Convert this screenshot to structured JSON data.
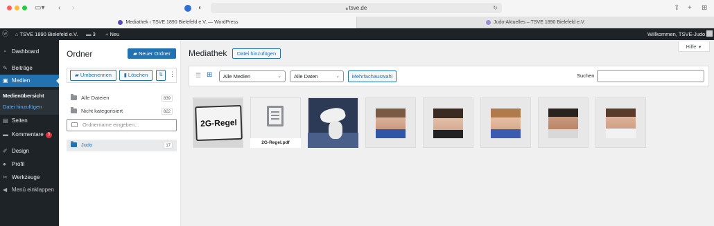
{
  "browser": {
    "url": "tsve.de",
    "tabs": [
      {
        "label": "Mediathek ‹ TSVE 1890 Bielefeld e.V. — WordPress"
      },
      {
        "label": "Judo-Aktuelles – TSVE 1890 Bielefeld e.V."
      }
    ]
  },
  "adminbar": {
    "site_name": "TSVE 1890 Bielefeld e.V.",
    "comments_count": "3",
    "new_label": "Neu",
    "welcome": "Willkommen, TSVE-Judo"
  },
  "menu": {
    "items": [
      {
        "label": "Dashboard",
        "icon": "dashboard-icon"
      },
      {
        "label": "Beiträge",
        "icon": "pin-icon"
      },
      {
        "label": "Medien",
        "icon": "media-icon"
      },
      {
        "label": "Seiten",
        "icon": "page-icon"
      },
      {
        "label": "Kommentare",
        "icon": "comment-icon",
        "badge": "3"
      },
      {
        "label": "Design",
        "icon": "brush-icon"
      },
      {
        "label": "Profil",
        "icon": "user-icon"
      },
      {
        "label": "Werkzeuge",
        "icon": "wrench-icon"
      },
      {
        "label": "Menü einklappen",
        "icon": "collapse-icon"
      }
    ],
    "submenu": [
      "Medienübersicht",
      "Datei hinzufügen"
    ],
    "colors": {
      "bg": "#1d2327",
      "current": "#2271b1",
      "badge": "#d63638"
    }
  },
  "folders": {
    "title": "Ordner",
    "new_folder_label": "Neuer Ordner",
    "rename_label": "Umbenennen",
    "delete_label": "Löschen",
    "all_files": {
      "label": "Alle Dateien",
      "count": "839"
    },
    "uncategorized": {
      "label": "Nicht kategorisiert",
      "count": "822"
    },
    "name_placeholder": "Ordnername eingeben...",
    "items": [
      {
        "label": "Judo",
        "count": "17"
      }
    ]
  },
  "media": {
    "title": "Mediathek",
    "add_file_label": "Datei hinzufügen",
    "help_label": "Hilfe",
    "filter_type": "Alle Medien",
    "filter_date": "Alle Daten",
    "bulk_select_label": "Mehrfachauswahl",
    "search_label": "Suchen",
    "pdf_name": "2G-Regel.pdf",
    "sign_text": "2G-Regel"
  }
}
